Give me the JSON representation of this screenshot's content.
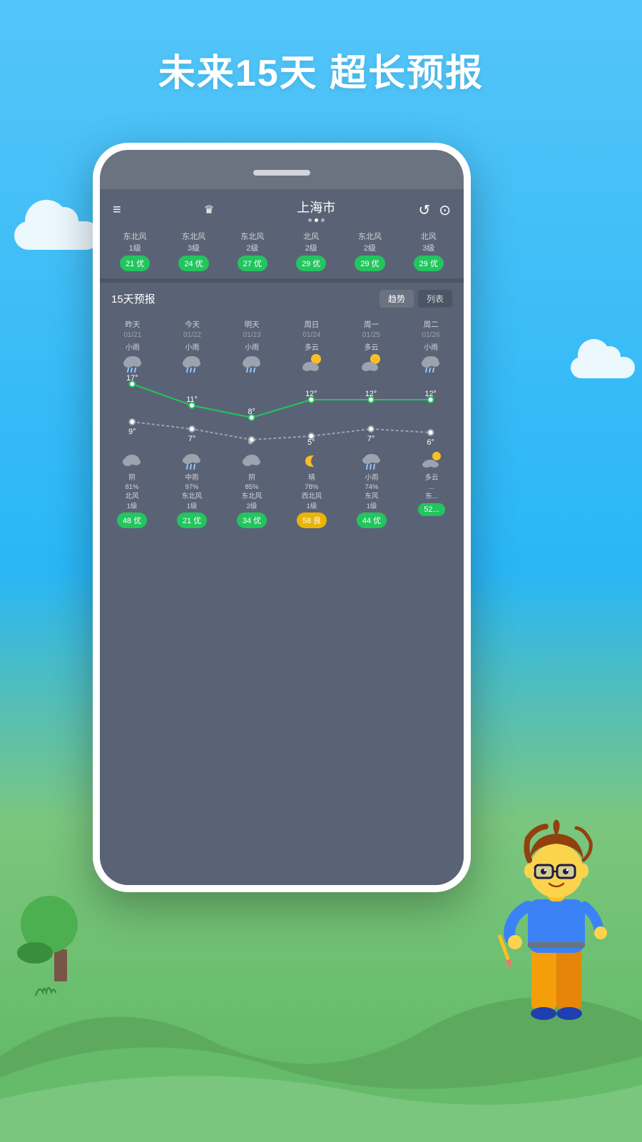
{
  "title": "未来15天 超长预报",
  "header": {
    "city": "上海市",
    "menu_icon": "≡",
    "crown_icon": "♛",
    "refresh_icon": "↺",
    "location_icon": "⊙"
  },
  "aqi_row": [
    {
      "wind": "东北风\n1级",
      "aqi": "21 优",
      "color": "green"
    },
    {
      "wind": "东北风\n3级",
      "aqi": "24 优",
      "color": "green"
    },
    {
      "wind": "东北风\n2级",
      "aqi": "27 优",
      "color": "green"
    },
    {
      "wind": "北风\n2级",
      "aqi": "29 优",
      "color": "green"
    },
    {
      "wind": "东北风\n2级",
      "aqi": "29 优",
      "color": "green"
    },
    {
      "wind": "北风\n3级",
      "aqi": "29 优",
      "color": "green"
    }
  ],
  "forecast_section": {
    "title": "15天预报",
    "tabs": [
      "趋势",
      "列表"
    ]
  },
  "days": [
    {
      "label": "昨天",
      "date": "01/21",
      "weather": "小雨",
      "icon": "🌧",
      "high": "17°",
      "low": "9°"
    },
    {
      "label": "今天",
      "date": "01/22",
      "weather": "小雨",
      "icon": "🌧",
      "high": "11°",
      "low": "7°"
    },
    {
      "label": "明天",
      "date": "01/23",
      "weather": "小雨",
      "icon": "🌧",
      "high": "8°",
      "low": "4°"
    },
    {
      "label": "周日",
      "date": "01/24",
      "weather": "多云",
      "icon": "⛅",
      "high": "12°",
      "low": "5°"
    },
    {
      "label": "周一",
      "date": "01/25",
      "weather": "多云",
      "icon": "⛅",
      "high": "12°",
      "low": "7°"
    },
    {
      "label": "周二",
      "date": "01/26",
      "weather": "小雨",
      "icon": "🌧",
      "high": "12°",
      "low": "6°"
    }
  ],
  "bottom_days": [
    {
      "icon": "☁",
      "weather": "阴",
      "humidity": "81%",
      "wind": "北风\n1级",
      "aqi": "48 优",
      "aqi_color": "green"
    },
    {
      "icon": "🌧",
      "weather": "中雨",
      "humidity": "97%",
      "wind": "东北风\n1级",
      "aqi": "21 优",
      "aqi_color": "green"
    },
    {
      "icon": "☁",
      "weather": "阴",
      "humidity": "85%",
      "wind": "东北风\n2级",
      "aqi": "34 优",
      "aqi_color": "green"
    },
    {
      "icon": "🌙",
      "weather": "晴",
      "humidity": "78%",
      "wind": "西北风\n1级",
      "aqi": "58 良",
      "aqi_color": "yellow"
    },
    {
      "icon": "🌧",
      "weather": "小雨",
      "humidity": "74%",
      "wind": "东风\n1级",
      "aqi": "44 优",
      "aqi_color": "green"
    },
    {
      "icon": "⛅",
      "weather": "多云",
      "humidity": "...",
      "wind": "东...",
      "aqi": "52...",
      "aqi_color": "green"
    }
  ],
  "chart": {
    "highs": [
      17,
      11,
      8,
      12,
      12,
      12
    ],
    "lows": [
      9,
      7,
      4,
      5,
      7,
      6
    ]
  },
  "colors": {
    "green_badge": "#22c55e",
    "yellow_badge": "#eab308",
    "app_bg": "#5a6375",
    "sky_top": "#54c5f8",
    "sky_mid": "#29b6f6",
    "grass": "#66bb6a"
  }
}
